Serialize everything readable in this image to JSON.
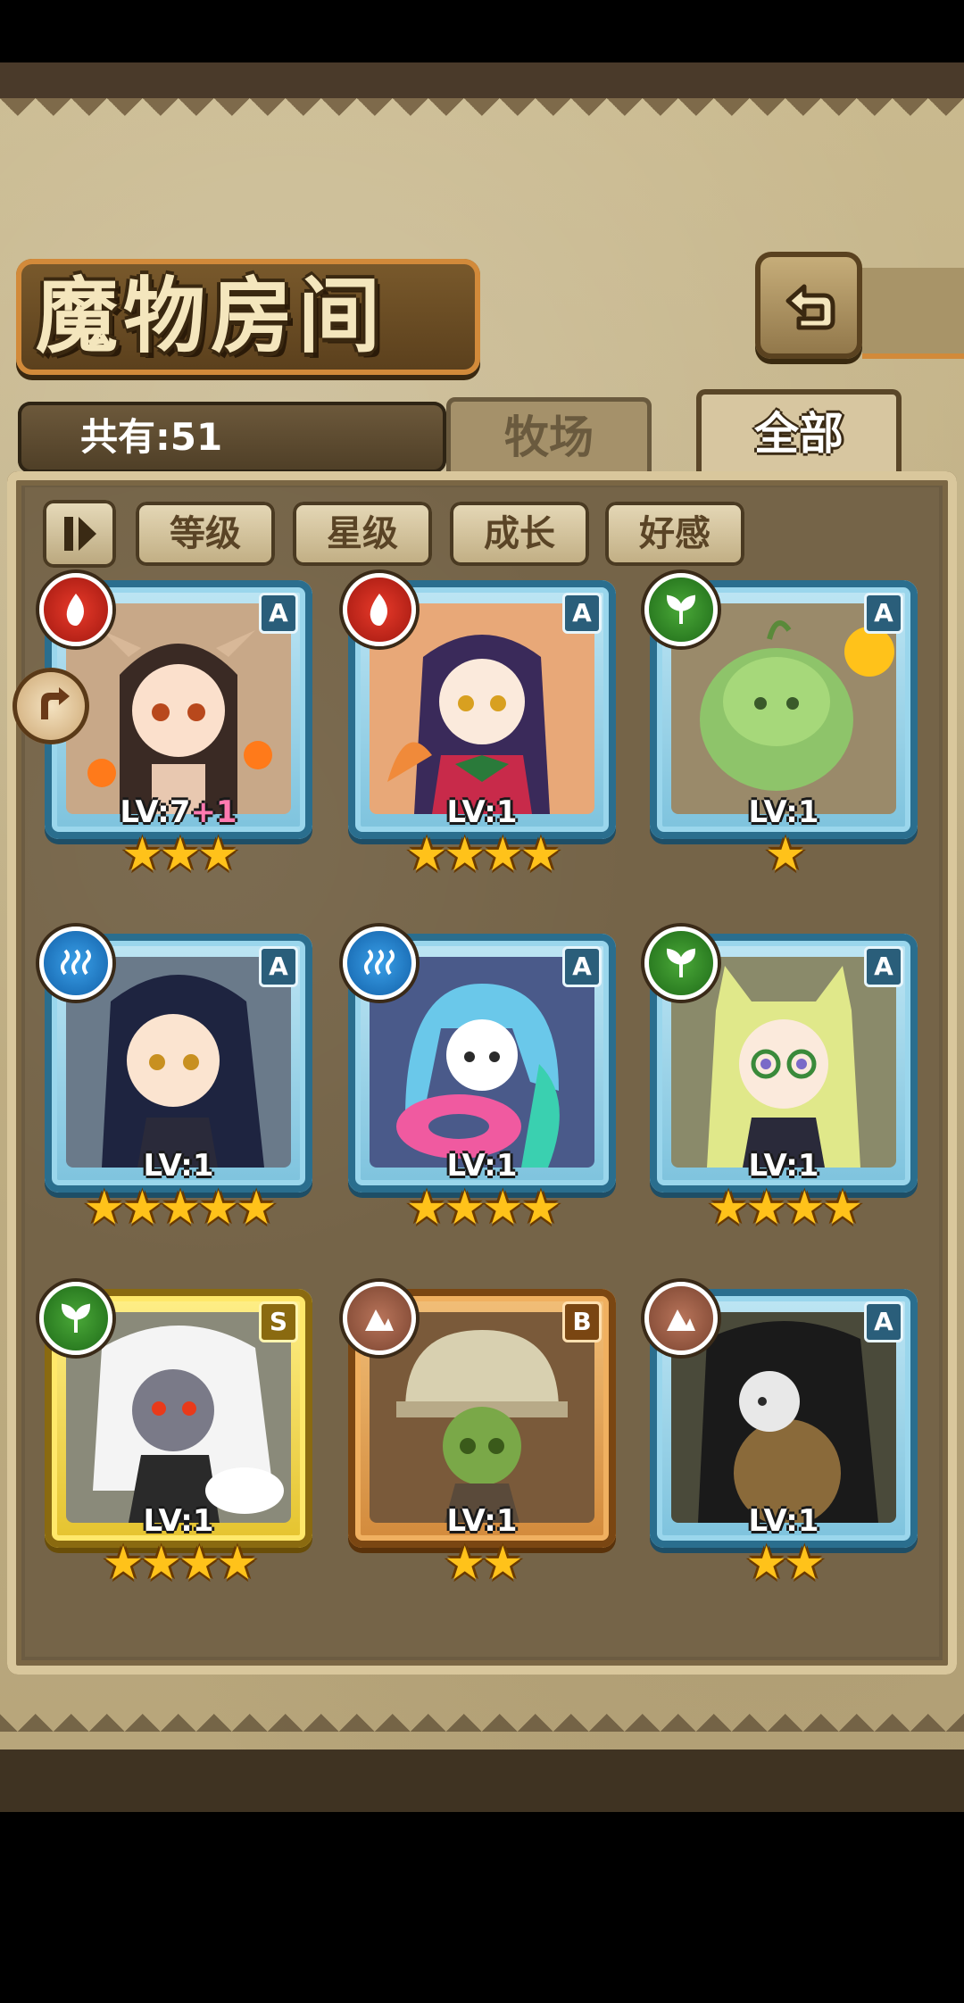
{
  "header": {
    "title": "魔物房间"
  },
  "summary": {
    "count_label": "共有:51"
  },
  "tabs": [
    {
      "label": "牧场",
      "active": false
    },
    {
      "label": "全部",
      "active": true
    }
  ],
  "filters": [
    "等级",
    "星级",
    "成长",
    "好感"
  ],
  "colors": {
    "fire": "#c8281c",
    "water": "#1e7ac8",
    "grass": "#2e8a22",
    "earth": "#9a5a40"
  },
  "monsters": [
    {
      "lv": "LV:7",
      "bonus": "+1",
      "rank": "A",
      "element": "fire",
      "stars": "★★★",
      "frame": "A"
    },
    {
      "lv": "LV:1",
      "bonus": "",
      "rank": "A",
      "element": "fire",
      "stars": "★★★★",
      "frame": "A"
    },
    {
      "lv": "LV:1",
      "bonus": "",
      "rank": "A",
      "element": "grass",
      "stars": "★",
      "frame": "A"
    },
    {
      "lv": "LV:1",
      "bonus": "",
      "rank": "A",
      "element": "water",
      "stars": "★★★★★",
      "frame": "A"
    },
    {
      "lv": "LV:1",
      "bonus": "",
      "rank": "A",
      "element": "water",
      "stars": "★★★★",
      "frame": "A"
    },
    {
      "lv": "LV:1",
      "bonus": "",
      "rank": "A",
      "element": "grass",
      "stars": "★★★★",
      "frame": "A"
    },
    {
      "lv": "LV:1",
      "bonus": "",
      "rank": "S",
      "element": "grass",
      "stars": "★★★★",
      "frame": "S"
    },
    {
      "lv": "LV:1",
      "bonus": "",
      "rank": "B",
      "element": "earth",
      "stars": "★★",
      "frame": "B"
    },
    {
      "lv": "LV:1",
      "bonus": "",
      "rank": "A",
      "element": "earth",
      "stars": "★★",
      "frame": "A"
    }
  ]
}
